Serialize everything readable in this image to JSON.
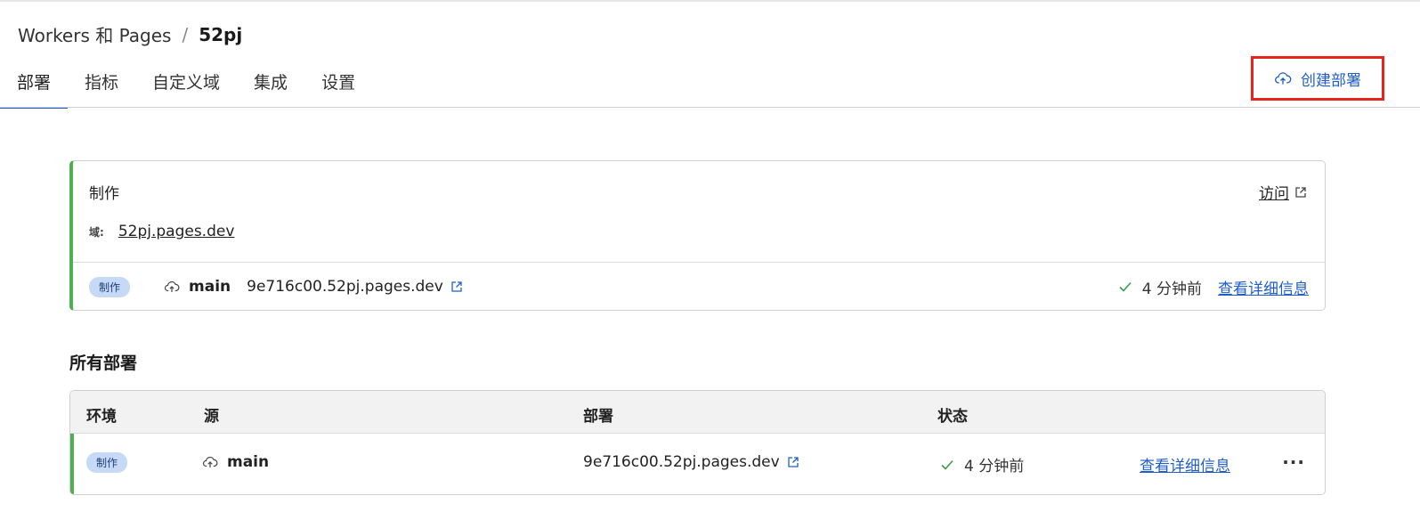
{
  "breadcrumb": {
    "parent": "Workers 和 Pages",
    "separator": "/",
    "current": "52pj"
  },
  "tabs": [
    {
      "label": "部署",
      "active": true
    },
    {
      "label": "指标"
    },
    {
      "label": "自定义域"
    },
    {
      "label": "集成"
    },
    {
      "label": "设置"
    }
  ],
  "create_button": {
    "label": "创建部署",
    "icon": "cloud-upload-icon"
  },
  "production": {
    "title": "制作",
    "visit_label": "访问",
    "domain_label": "域:",
    "domain": "52pj.pages.dev",
    "badge": "制作",
    "branch": "main",
    "deployment_url": "9e716c00.52pj.pages.dev",
    "status_time": "4 分钟前",
    "details_label": "查看详细信息"
  },
  "all_deployments": {
    "title": "所有部署",
    "columns": [
      "环境",
      "源",
      "部署",
      "状态"
    ],
    "rows": [
      {
        "environment": "制作",
        "branch": "main",
        "deployment_url": "9e716c00.52pj.pages.dev",
        "status_time": "4 分钟前",
        "details_label": "查看详细信息",
        "more": "···"
      }
    ]
  },
  "colors": {
    "accent": "#1f5ec9",
    "success": "#4caf50",
    "highlight": "#e8231c",
    "badge_bg": "#c6d9f7"
  }
}
